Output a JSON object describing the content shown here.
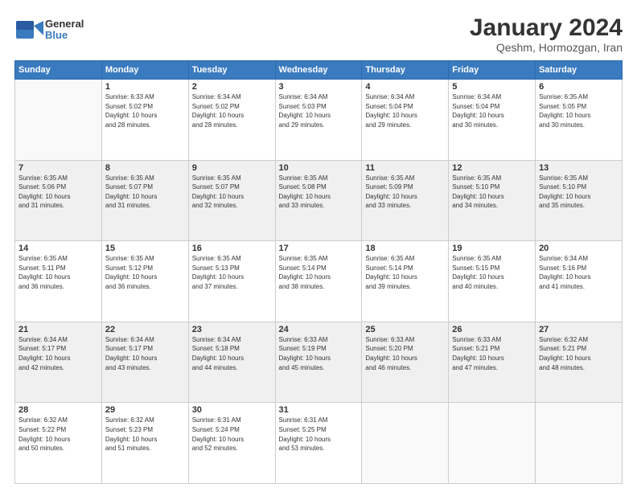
{
  "logo": {
    "general": "General",
    "blue": "Blue"
  },
  "header": {
    "month": "January 2024",
    "location": "Qeshm, Hormozgan, Iran"
  },
  "weekdays": [
    "Sunday",
    "Monday",
    "Tuesday",
    "Wednesday",
    "Thursday",
    "Friday",
    "Saturday"
  ],
  "weeks": [
    [
      {
        "day": "",
        "info": ""
      },
      {
        "day": "1",
        "info": "Sunrise: 6:33 AM\nSunset: 5:02 PM\nDaylight: 10 hours\nand 28 minutes."
      },
      {
        "day": "2",
        "info": "Sunrise: 6:34 AM\nSunset: 5:02 PM\nDaylight: 10 hours\nand 28 minutes."
      },
      {
        "day": "3",
        "info": "Sunrise: 6:34 AM\nSunset: 5:03 PM\nDaylight: 10 hours\nand 29 minutes."
      },
      {
        "day": "4",
        "info": "Sunrise: 6:34 AM\nSunset: 5:04 PM\nDaylight: 10 hours\nand 29 minutes."
      },
      {
        "day": "5",
        "info": "Sunrise: 6:34 AM\nSunset: 5:04 PM\nDaylight: 10 hours\nand 30 minutes."
      },
      {
        "day": "6",
        "info": "Sunrise: 6:35 AM\nSunset: 5:05 PM\nDaylight: 10 hours\nand 30 minutes."
      }
    ],
    [
      {
        "day": "7",
        "info": "Sunrise: 6:35 AM\nSunset: 5:06 PM\nDaylight: 10 hours\nand 31 minutes."
      },
      {
        "day": "8",
        "info": "Sunrise: 6:35 AM\nSunset: 5:07 PM\nDaylight: 10 hours\nand 31 minutes."
      },
      {
        "day": "9",
        "info": "Sunrise: 6:35 AM\nSunset: 5:07 PM\nDaylight: 10 hours\nand 32 minutes."
      },
      {
        "day": "10",
        "info": "Sunrise: 6:35 AM\nSunset: 5:08 PM\nDaylight: 10 hours\nand 33 minutes."
      },
      {
        "day": "11",
        "info": "Sunrise: 6:35 AM\nSunset: 5:09 PM\nDaylight: 10 hours\nand 33 minutes."
      },
      {
        "day": "12",
        "info": "Sunrise: 6:35 AM\nSunset: 5:10 PM\nDaylight: 10 hours\nand 34 minutes."
      },
      {
        "day": "13",
        "info": "Sunrise: 6:35 AM\nSunset: 5:10 PM\nDaylight: 10 hours\nand 35 minutes."
      }
    ],
    [
      {
        "day": "14",
        "info": "Sunrise: 6:35 AM\nSunset: 5:11 PM\nDaylight: 10 hours\nand 36 minutes."
      },
      {
        "day": "15",
        "info": "Sunrise: 6:35 AM\nSunset: 5:12 PM\nDaylight: 10 hours\nand 36 minutes."
      },
      {
        "day": "16",
        "info": "Sunrise: 6:35 AM\nSunset: 5:13 PM\nDaylight: 10 hours\nand 37 minutes."
      },
      {
        "day": "17",
        "info": "Sunrise: 6:35 AM\nSunset: 5:14 PM\nDaylight: 10 hours\nand 38 minutes."
      },
      {
        "day": "18",
        "info": "Sunrise: 6:35 AM\nSunset: 5:14 PM\nDaylight: 10 hours\nand 39 minutes."
      },
      {
        "day": "19",
        "info": "Sunrise: 6:35 AM\nSunset: 5:15 PM\nDaylight: 10 hours\nand 40 minutes."
      },
      {
        "day": "20",
        "info": "Sunrise: 6:34 AM\nSunset: 5:16 PM\nDaylight: 10 hours\nand 41 minutes."
      }
    ],
    [
      {
        "day": "21",
        "info": "Sunrise: 6:34 AM\nSunset: 5:17 PM\nDaylight: 10 hours\nand 42 minutes."
      },
      {
        "day": "22",
        "info": "Sunrise: 6:34 AM\nSunset: 5:17 PM\nDaylight: 10 hours\nand 43 minutes."
      },
      {
        "day": "23",
        "info": "Sunrise: 6:34 AM\nSunset: 5:18 PM\nDaylight: 10 hours\nand 44 minutes."
      },
      {
        "day": "24",
        "info": "Sunrise: 6:33 AM\nSunset: 5:19 PM\nDaylight: 10 hours\nand 45 minutes."
      },
      {
        "day": "25",
        "info": "Sunrise: 6:33 AM\nSunset: 5:20 PM\nDaylight: 10 hours\nand 46 minutes."
      },
      {
        "day": "26",
        "info": "Sunrise: 6:33 AM\nSunset: 5:21 PM\nDaylight: 10 hours\nand 47 minutes."
      },
      {
        "day": "27",
        "info": "Sunrise: 6:32 AM\nSunset: 5:21 PM\nDaylight: 10 hours\nand 48 minutes."
      }
    ],
    [
      {
        "day": "28",
        "info": "Sunrise: 6:32 AM\nSunset: 5:22 PM\nDaylight: 10 hours\nand 50 minutes."
      },
      {
        "day": "29",
        "info": "Sunrise: 6:32 AM\nSunset: 5:23 PM\nDaylight: 10 hours\nand 51 minutes."
      },
      {
        "day": "30",
        "info": "Sunrise: 6:31 AM\nSunset: 5:24 PM\nDaylight: 10 hours\nand 52 minutes."
      },
      {
        "day": "31",
        "info": "Sunrise: 6:31 AM\nSunset: 5:25 PM\nDaylight: 10 hours\nand 53 minutes."
      },
      {
        "day": "",
        "info": ""
      },
      {
        "day": "",
        "info": ""
      },
      {
        "day": "",
        "info": ""
      }
    ]
  ]
}
